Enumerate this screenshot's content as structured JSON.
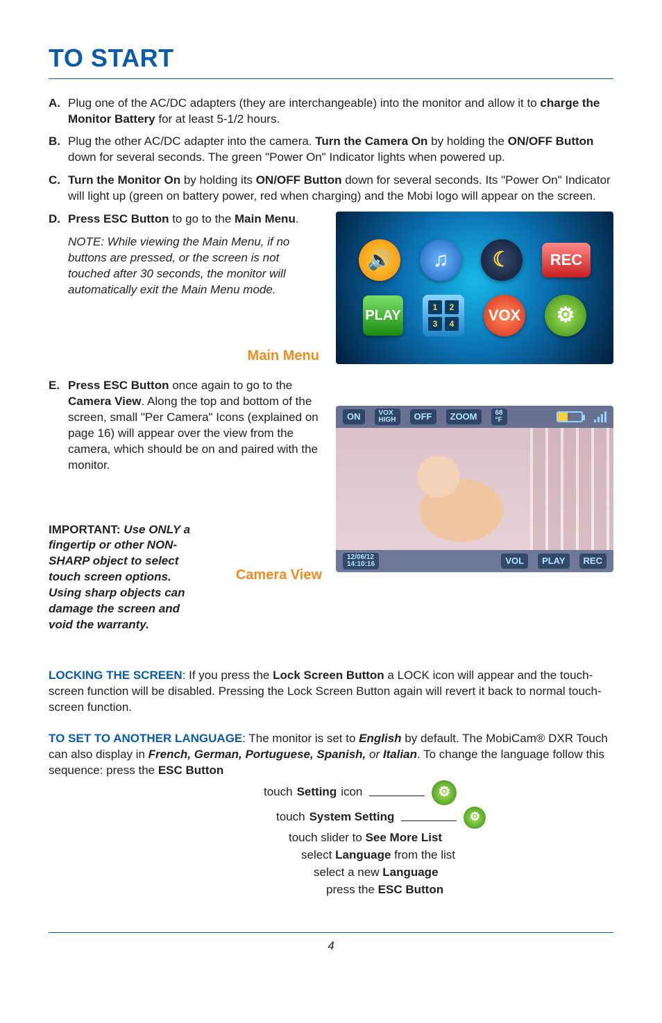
{
  "title": "TO START",
  "items": {
    "a": {
      "letter": "A.",
      "p1a": "Plug one of the AC/DC adapters (they are interchangeable) into the monitor and allow it to ",
      "p1b": "charge the Monitor Battery",
      "p1c": " for at least 5-1/2 hours."
    },
    "b": {
      "letter": "B.",
      "p1a": "Plug the other AC/DC adapter into the camera. ",
      "p1b": "Turn the Camera On",
      "p1c": " by holding the ",
      "p1d": "ON/OFF Button",
      "p1e": " down for several seconds. The green \"Power On\" Indicator lights when powered up."
    },
    "c": {
      "letter": "C.",
      "p1a": "Turn the Monitor On",
      "p1b": " by holding its ",
      "p1c": "ON/OFF Button",
      "p1d": " down for several seconds. Its \"Power On\" Indicator will light up (green on battery power, red when charging) and the Mobi logo will appear on the screen."
    },
    "d": {
      "letter": "D.",
      "p1a": "Press ESC Button",
      "p1b": " to go to the ",
      "p1c": "Main Menu",
      "p1d": "."
    },
    "note": "NOTE:  While viewing the Main Menu, if no buttons are pressed, or the screen is not touched after 30 seconds, the monitor will automatically exit the Main Menu mode.",
    "main_menu_label": "Main Menu",
    "e": {
      "letter": "E.",
      "p1a": "Press ESC Button",
      "p1b": " once again to go to the ",
      "p1c": "Camera View",
      "p1d": ". Along the top and bottom of the screen, small \"Per Camera\" Icons (explained on page 16) will appear over the view from the camera, which should be on and paired with the monitor."
    },
    "important": {
      "head": "IMPORTANT:  ",
      "body": "Use ONLY a fingertip or other NON-SHARP object to select touch screen options. Using sharp objects can damage the screen and void the warranty."
    },
    "camera_view_label": "Camera View"
  },
  "menu_icons": {
    "speaker": "🔊",
    "music": "♫",
    "moon": "☾",
    "rec": "REC",
    "play": "PLAY",
    "q1": "1",
    "q2": "2",
    "q3": "3",
    "q4": "4",
    "vox": "VOX",
    "gear": "⚙"
  },
  "cam_overlay": {
    "top": {
      "on": "ON",
      "vox": "VOX\nHIGH",
      "off": "OFF",
      "zoom": "ZOOM",
      "temp": "68\n°F"
    },
    "bot": {
      "ts": "12/06/12\n14:10:16",
      "vol": "VOL",
      "play": "PLAY",
      "rec": "REC"
    }
  },
  "locking": {
    "head": "LOCKING THE SCREEN",
    "p1a": ":  If you press the ",
    "p1b": "Lock Screen Button",
    "p1c": " a LOCK icon will appear and the touch-screen function will be disabled. Pressing the Lock Screen Button again will revert it back to normal touch-screen function."
  },
  "language": {
    "head": "TO SET TO ANOTHER LANGUAGE",
    "p1a": ":  The monitor is set to ",
    "p1b": "English",
    "p1c": " by default. The MobiCam® DXR Touch can also display in ",
    "p1d": "French, German, Portuguese, Spanish,",
    "p1e": " or ",
    "p1f": "Italian",
    "p1g": ". To change the language follow this sequence:   press the ",
    "p1h": "ESC Button",
    "steps": {
      "s1a": "touch ",
      "s1b": "Setting",
      "s1c": " icon",
      "s2a": "touch ",
      "s2b": "System Setting",
      "s3a": "touch slider to ",
      "s3b": "See More List",
      "s4a": "select ",
      "s4b": "Language",
      "s4c": " from the list",
      "s5a": "select a new ",
      "s5b": "Language",
      "s6a": "press the ",
      "s6b": "ESC Button"
    },
    "gear": "⚙"
  },
  "page_number": "4"
}
